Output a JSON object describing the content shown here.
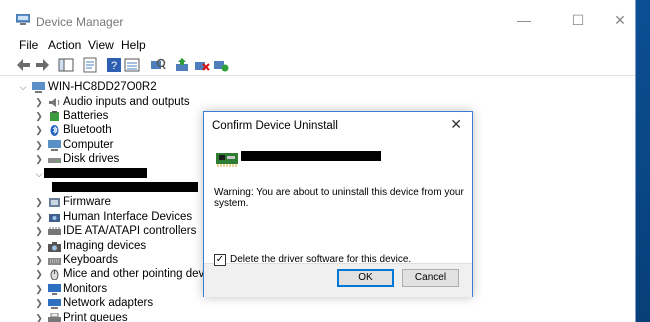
{
  "window": {
    "title": "Device Manager",
    "minimize": "—",
    "maximize": "☐",
    "close": "✕"
  },
  "menu": [
    "File",
    "Action",
    "View",
    "Help"
  ],
  "tree": {
    "root": "WIN-HC8DD27O0R2",
    "items": [
      "Audio inputs and outputs",
      "Batteries",
      "Bluetooth",
      "Computer",
      "Disk drives",
      "Firmware",
      "Human Interface Devices",
      "IDE ATA/ATAPI controllers",
      "Imaging devices",
      "Keyboards",
      "Mice and other pointing devices",
      "Monitors",
      "Network adapters",
      "Print queues"
    ]
  },
  "dialog": {
    "title": "Confirm Device Uninstall",
    "close": "✕",
    "warning": "Warning: You are about to uninstall this device from your system.",
    "checkbox_label": "Delete the driver software for this device.",
    "checkbox_mark": "✓",
    "ok": "OK",
    "cancel": "Cancel"
  },
  "colors": {
    "desktop": "#0a4c8c",
    "accent": "#0078d7"
  }
}
